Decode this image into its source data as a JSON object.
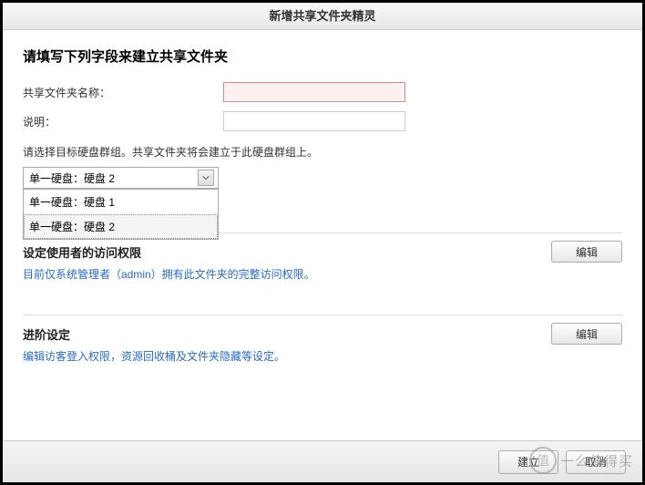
{
  "title": "新增共享文件夹精灵",
  "heading": "请填写下列字段来建立共享文件夹",
  "fields": {
    "name_label": "共享文件夹名称：",
    "name_value": "",
    "desc_label": "说明：",
    "desc_value": ""
  },
  "disk_instruction": "请选择目标硬盘群组。共享文件夹将会建立于此硬盘群组上。",
  "select": {
    "value": "单一硬盘：硬盘 2",
    "options": [
      "单一硬盘：硬盘 1",
      "单一硬盘：硬盘 2"
    ]
  },
  "section_access": {
    "title_partial": "设定使用者的访问权限",
    "desc": "目前仅系统管理者（admin）拥有此文件夹的完整访问权限。",
    "edit": "编辑"
  },
  "section_advanced": {
    "title": "进阶设定",
    "desc": "编辑访客登入权限，资源回收桶及文件夹隐藏等设定。",
    "edit": "编辑"
  },
  "buttons": {
    "create": "建立",
    "cancel": "取消"
  },
  "watermark": {
    "badge": "值",
    "text": "一么值得买"
  }
}
